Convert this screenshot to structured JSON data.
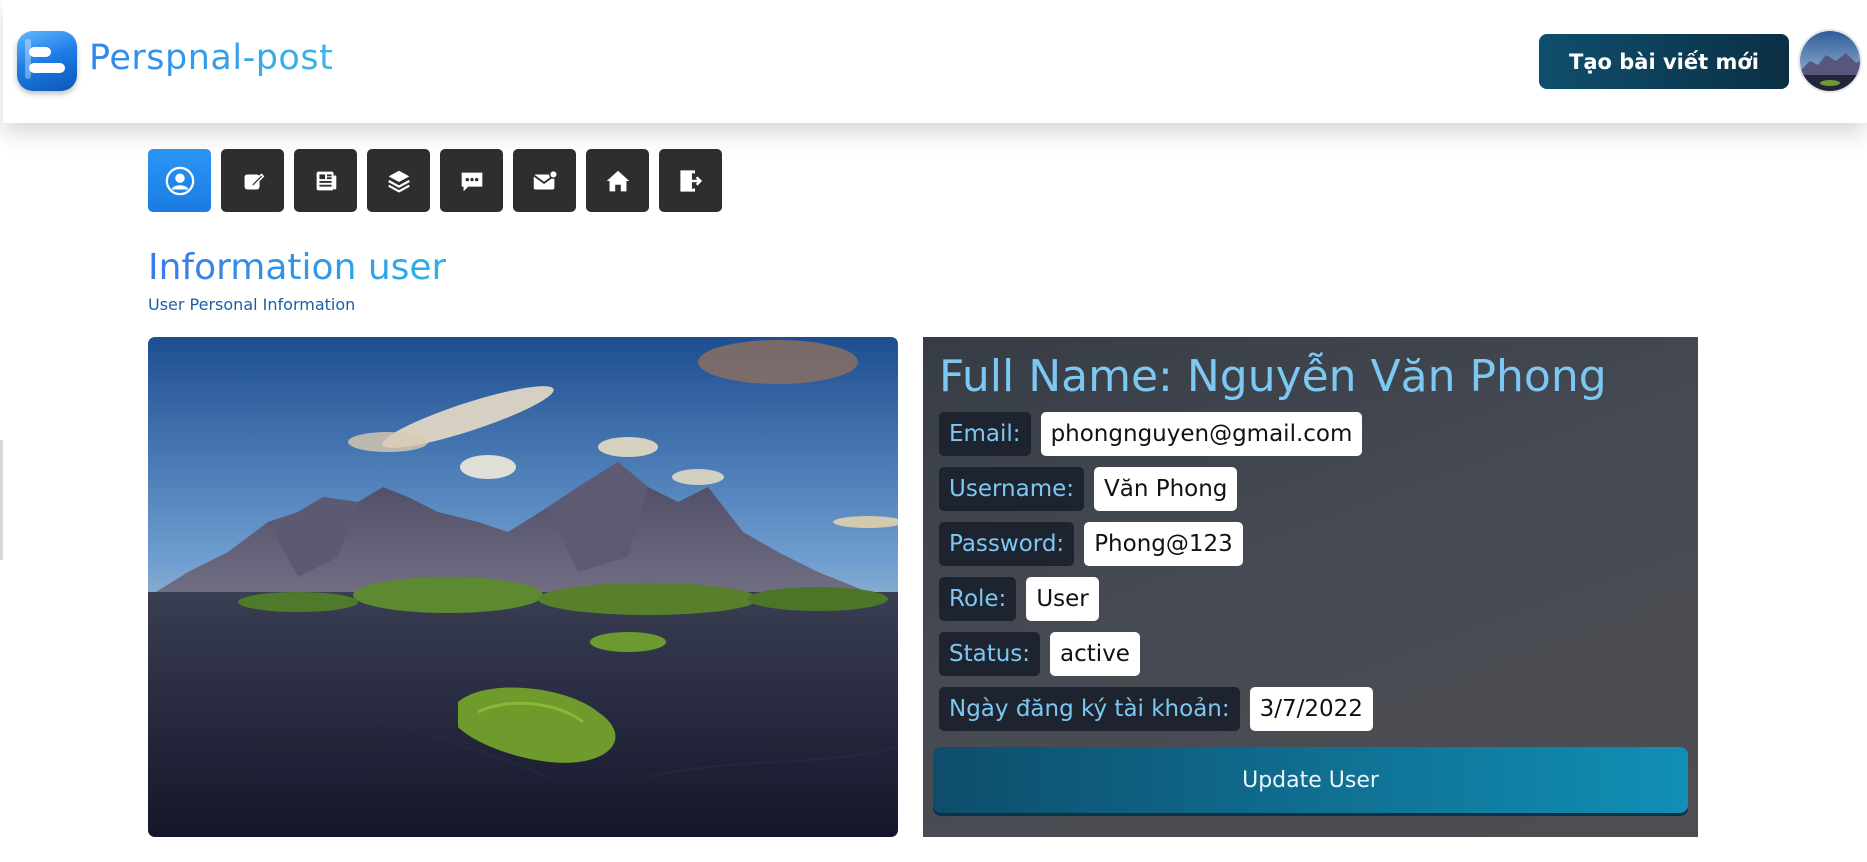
{
  "header": {
    "brand": "Perspnal-post",
    "new_post_label": "Tạo bài viết mới"
  },
  "toolbar": {
    "buttons": [
      {
        "icon": "user-profile-icon",
        "active": true
      },
      {
        "icon": "edit-icon",
        "active": false
      },
      {
        "icon": "newspaper-icon",
        "active": false
      },
      {
        "icon": "layers-icon",
        "active": false
      },
      {
        "icon": "chat-icon",
        "active": false
      },
      {
        "icon": "mail-icon",
        "active": false
      },
      {
        "icon": "home-icon",
        "active": false
      },
      {
        "icon": "logout-icon",
        "active": false
      }
    ]
  },
  "page": {
    "title": "Information user",
    "subtitle": "User Personal Information"
  },
  "user": {
    "full_name": "Full Name: Nguyễn Văn Phong",
    "fields": [
      {
        "label": "Email:",
        "value": "phongnguyen@gmail.com"
      },
      {
        "label": "Username:",
        "value": "Văn Phong"
      },
      {
        "label": "Password:",
        "value": "Phong@123"
      },
      {
        "label": "Role:",
        "value": "User"
      },
      {
        "label": "Status:",
        "value": "active"
      },
      {
        "label": "Ngày đăng ký tài khoản:",
        "value": "3/7/2022"
      }
    ],
    "update_label": "Update User"
  },
  "colors": {
    "accent": "#2b96f5",
    "card_label_text": "#7dc8f2",
    "button_dark": "#0b2f45",
    "button_teal": "#118fb6"
  }
}
